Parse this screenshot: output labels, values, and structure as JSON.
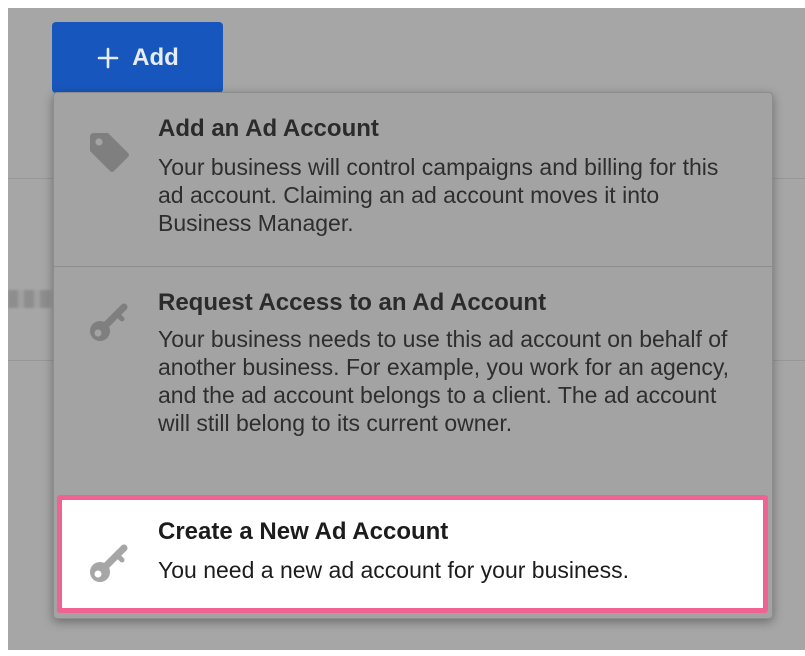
{
  "add_button": {
    "label": "Add",
    "icon": "plus-icon",
    "color": "#1757bd"
  },
  "menu": {
    "items": [
      {
        "title": "Add an Ad Account",
        "description": "Your business will control campaigns and billing for this ad account. Claiming an ad account moves it into Business Manager.",
        "icon": "tag-icon"
      },
      {
        "title": "Request Access to an Ad Account",
        "description": "Your business needs to use this ad account on behalf of another business. For example, you work for an agency, and the ad account belongs to a client. The ad account will still belong to its current owner.",
        "icon": "key-icon"
      },
      {
        "title": "Create a New Ad Account",
        "description": "You need a new ad account for your business.",
        "icon": "key-icon",
        "highlighted": true,
        "highlight_color": "#f06292"
      }
    ]
  }
}
